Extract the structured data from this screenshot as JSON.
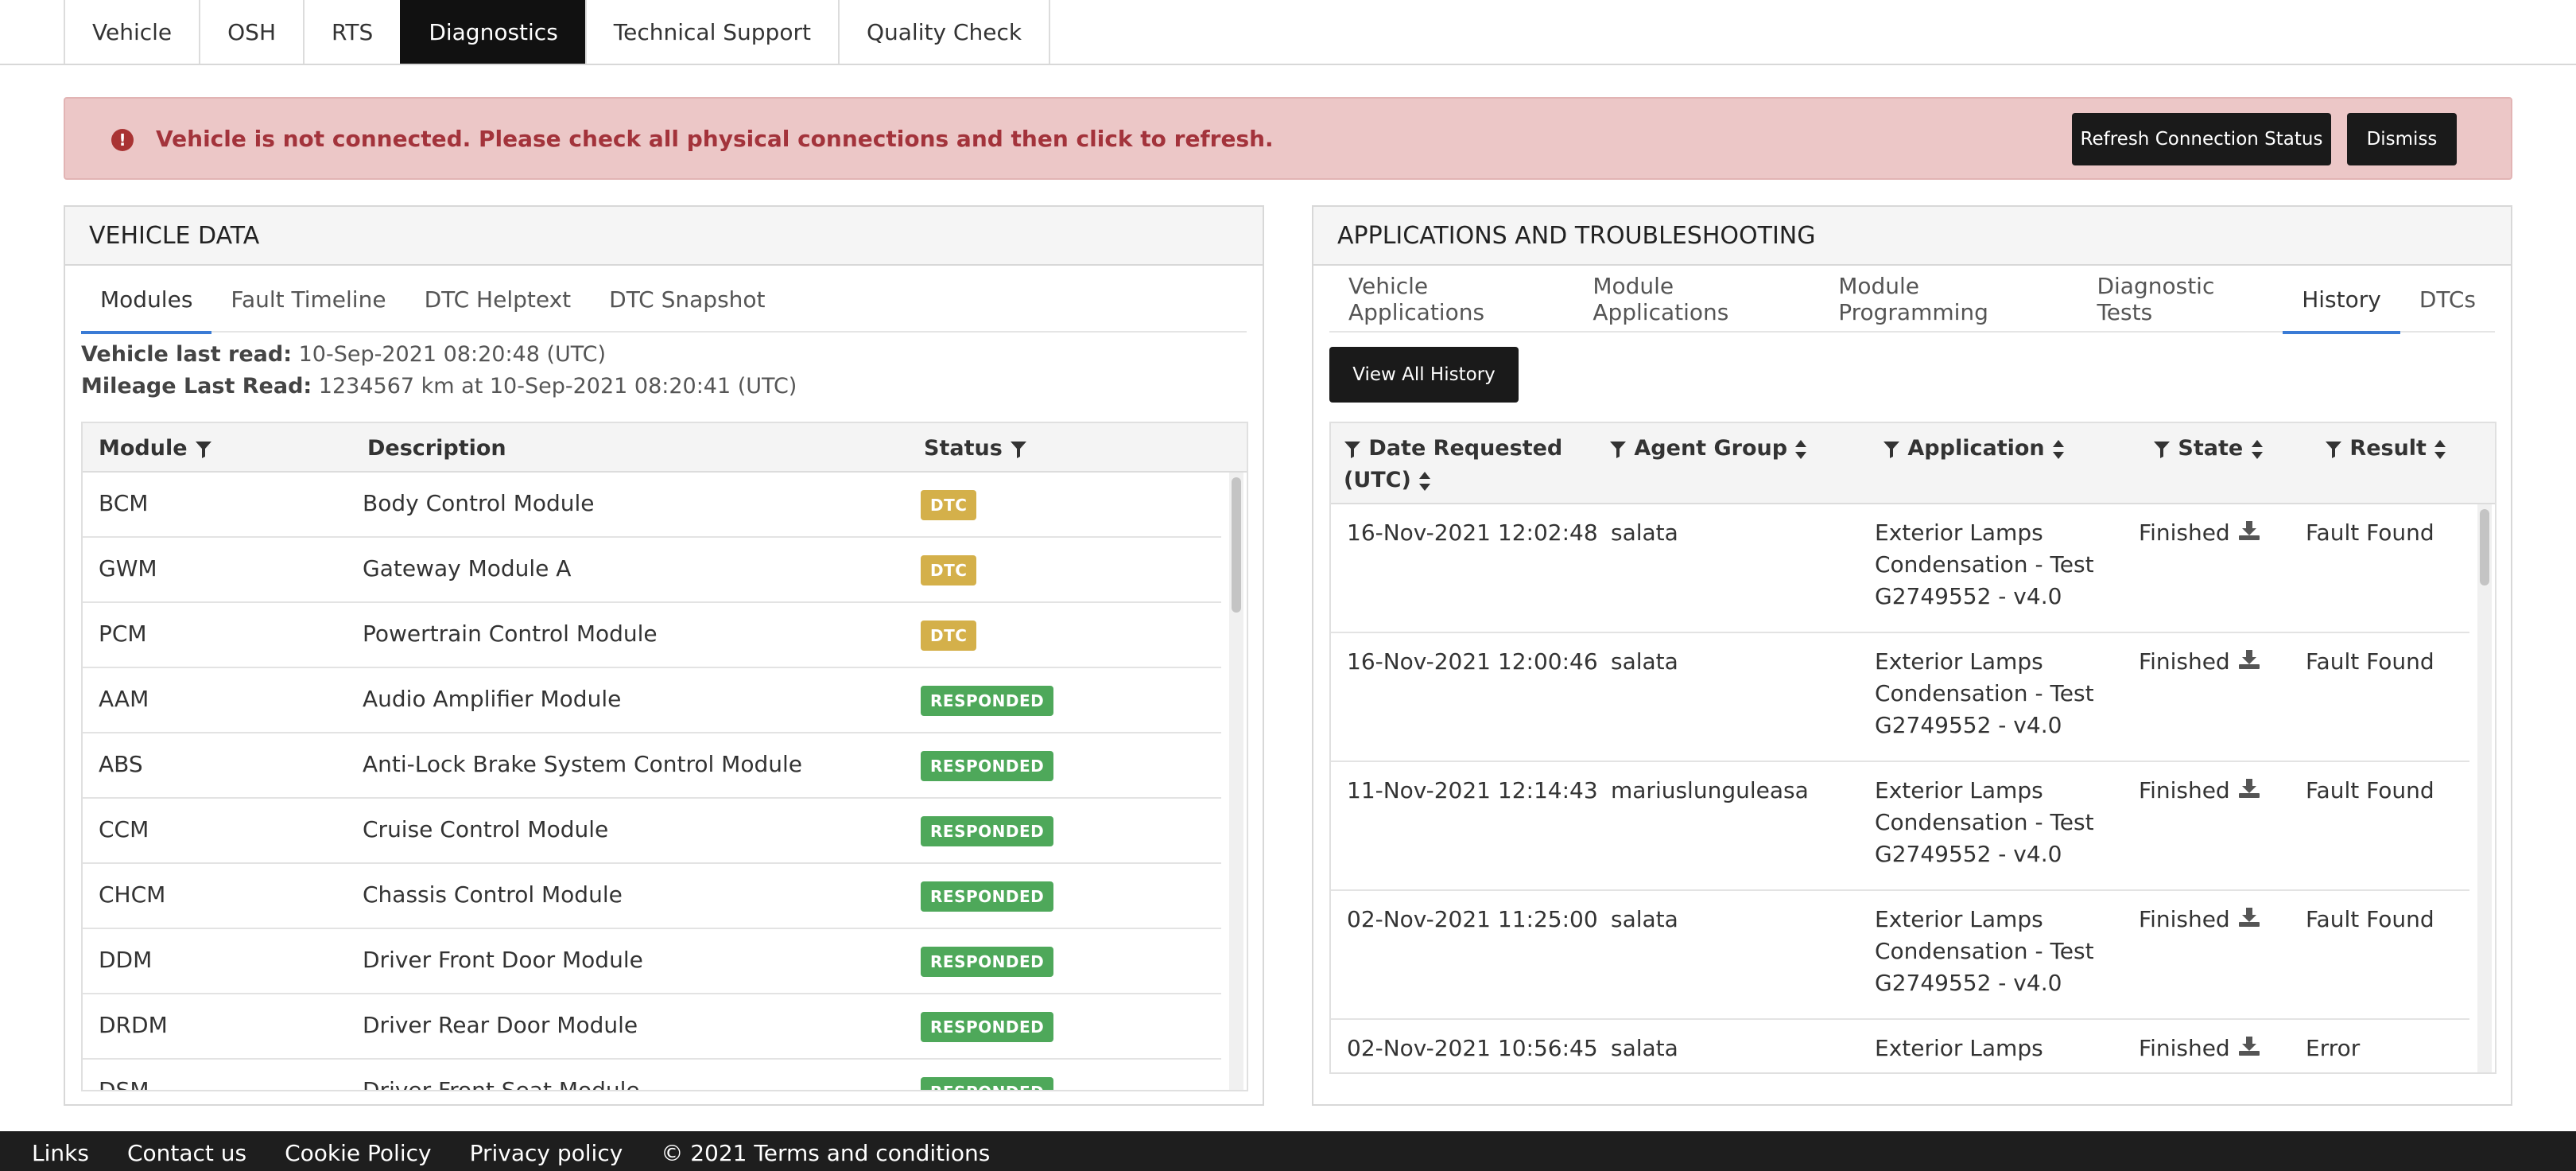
{
  "top_tabs": {
    "items": [
      {
        "label": "Vehicle"
      },
      {
        "label": "OSH"
      },
      {
        "label": "RTS"
      },
      {
        "label": "Diagnostics"
      },
      {
        "label": "Technical Support"
      },
      {
        "label": "Quality Check"
      }
    ],
    "active": "Diagnostics"
  },
  "alert": {
    "message": "Vehicle is not connected. Please check all physical connections and then click to refresh.",
    "refresh_label": "Refresh Connection Status",
    "dismiss_label": "Dismiss",
    "icon": "exclamation-circle-icon"
  },
  "vehicle_data": {
    "title": "VEHICLE DATA",
    "tabs": [
      {
        "label": "Modules"
      },
      {
        "label": "Fault Timeline"
      },
      {
        "label": "DTC Helptext"
      },
      {
        "label": "DTC Snapshot"
      }
    ],
    "active_tab": "Modules",
    "last_read_label": "Vehicle last read:",
    "last_read_value": "10-Sep-2021 08:20:48 (UTC)",
    "mileage_label": "Mileage Last Read:",
    "mileage_value": "1234567 km at 10-Sep-2021 08:20:41 (UTC)",
    "columns": {
      "module": "Module",
      "description": "Description",
      "status": "Status"
    },
    "rows": [
      {
        "module": "BCM",
        "description": "Body Control Module",
        "status": "DTC"
      },
      {
        "module": "GWM",
        "description": "Gateway Module A",
        "status": "DTC"
      },
      {
        "module": "PCM",
        "description": "Powertrain Control Module",
        "status": "DTC"
      },
      {
        "module": "AAM",
        "description": "Audio Amplifier Module",
        "status": "RESPONDED"
      },
      {
        "module": "ABS",
        "description": "Anti-Lock Brake System Control Module",
        "status": "RESPONDED"
      },
      {
        "module": "CCM",
        "description": "Cruise Control Module",
        "status": "RESPONDED"
      },
      {
        "module": "CHCM",
        "description": "Chassis Control Module",
        "status": "RESPONDED"
      },
      {
        "module": "DDM",
        "description": "Driver Front Door Module",
        "status": "RESPONDED"
      },
      {
        "module": "DRDM",
        "description": "Driver Rear Door Module",
        "status": "RESPONDED"
      },
      {
        "module": "DSM",
        "description": "Driver Front Seat Module",
        "status": "RESPONDED"
      }
    ]
  },
  "apps": {
    "title": "APPLICATIONS AND TROUBLESHOOTING",
    "tabs": [
      {
        "label": "Vehicle Applications"
      },
      {
        "label": "Module Applications"
      },
      {
        "label": "Module Programming"
      },
      {
        "label": "Diagnostic Tests"
      },
      {
        "label": "History"
      },
      {
        "label": "DTCs"
      }
    ],
    "active_tab": "History",
    "view_all_label": "View All History",
    "columns": {
      "date_line1": "Date Requested",
      "date_line2": "(UTC)",
      "agent": "Agent Group",
      "application": "Application",
      "state": "State",
      "result": "Result"
    },
    "rows": [
      {
        "date": "16-Nov-2021 12:02:48",
        "agent": "salata",
        "application": "Exterior Lamps Condensation - Test G2749552 - v4.0",
        "state": "Finished",
        "result": "Fault Found"
      },
      {
        "date": "16-Nov-2021 12:00:46",
        "agent": "salata",
        "application": "Exterior Lamps Condensation - Test G2749552 - v4.0",
        "state": "Finished",
        "result": "Fault Found"
      },
      {
        "date": "11-Nov-2021 12:14:43",
        "agent": "mariuslunguleasa",
        "application": "Exterior Lamps Condensation - Test G2749552 - v4.0",
        "state": "Finished",
        "result": "Fault Found"
      },
      {
        "date": "02-Nov-2021 11:25:00",
        "agent": "salata",
        "application": "Exterior Lamps Condensation - Test G2749552 - v4.0",
        "state": "Finished",
        "result": "Fault Found"
      },
      {
        "date": "02-Nov-2021 10:56:45",
        "agent": "salata",
        "application": "Exterior Lamps",
        "state": "Finished",
        "result": "Error"
      }
    ]
  },
  "footer": {
    "links": [
      {
        "label": "Links"
      },
      {
        "label": "Contact us"
      },
      {
        "label": "Cookie Policy"
      },
      {
        "label": "Privacy policy"
      },
      {
        "label": "© 2021 Terms and conditions"
      }
    ]
  },
  "colors": {
    "alert_bg": "#ecc7c7",
    "alert_text": "#a3333b",
    "dtc_badge": "#d4b04a",
    "responded_badge": "#4ea85a",
    "active_tab_underline": "#3a7bd5",
    "dark_button": "#1a1a1a"
  }
}
